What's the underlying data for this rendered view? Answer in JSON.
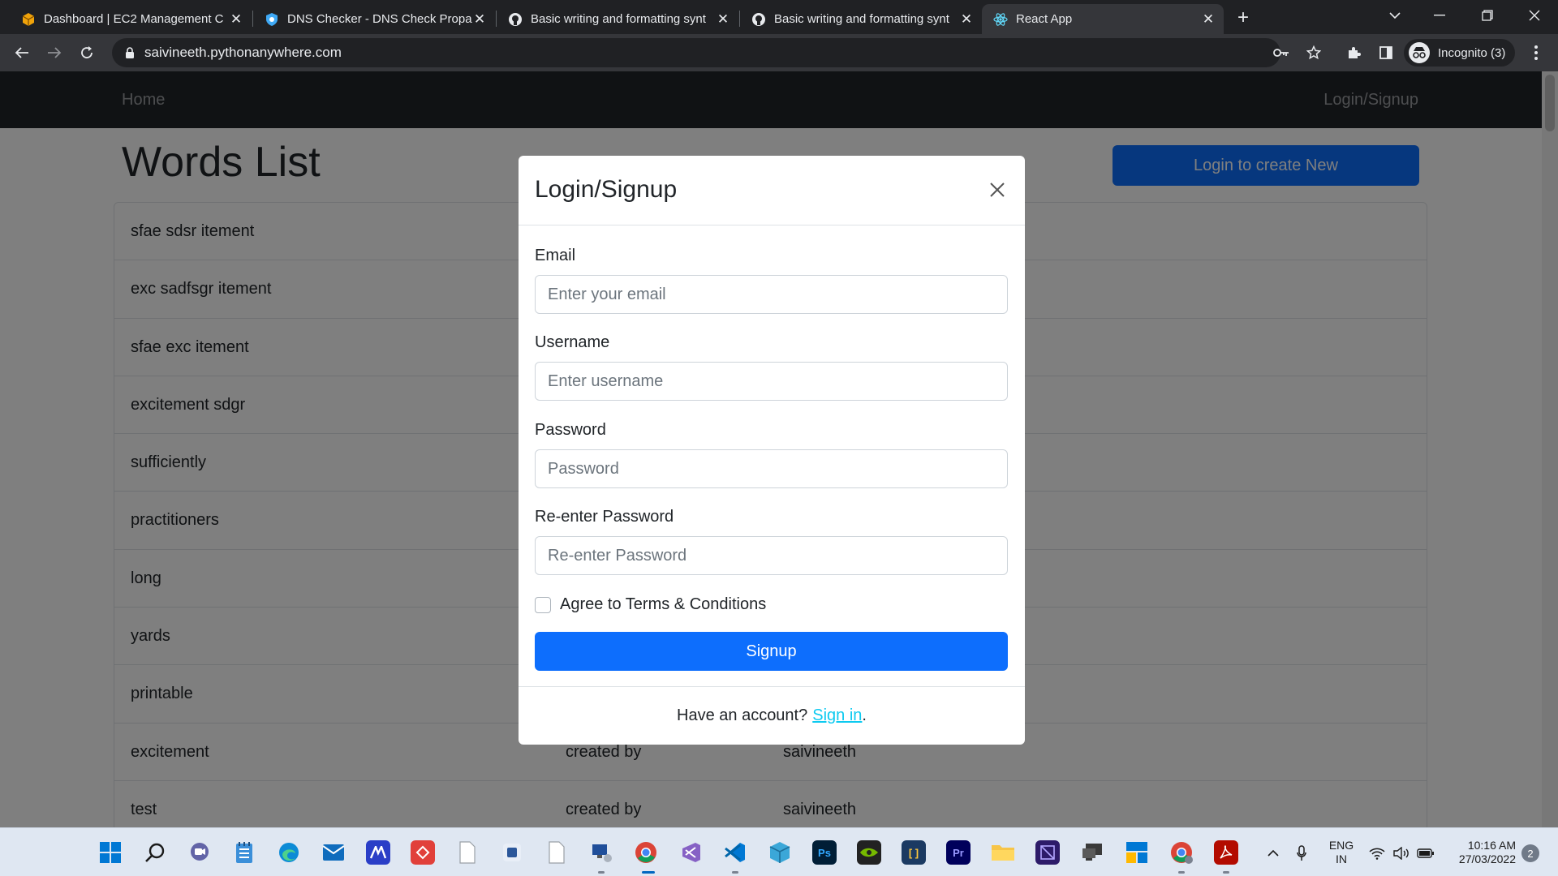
{
  "browser": {
    "tabs": [
      {
        "title": "Dashboard | EC2 Management C",
        "icon": "aws-cube-icon",
        "active": false
      },
      {
        "title": "DNS Checker - DNS Check Propa",
        "icon": "dns-checker-icon",
        "active": false
      },
      {
        "title": "Basic writing and formatting synt",
        "icon": "github-icon",
        "active": false
      },
      {
        "title": "Basic writing and formatting synt",
        "icon": "github-icon",
        "active": false
      },
      {
        "title": "React App",
        "icon": "react-icon",
        "active": true
      }
    ],
    "url": "saivineeth.pythonanywhere.com",
    "profile_label": "Incognito (3)"
  },
  "app": {
    "nav_home": "Home",
    "nav_login": "Login/Signup",
    "page_title": "Words List",
    "create_button": "Login to create New",
    "words": [
      {
        "word": "sfae sdsr itement",
        "by": "",
        "user": ""
      },
      {
        "word": "exc sadfsgr itement",
        "by": "",
        "user": ""
      },
      {
        "word": "sfae exc itement",
        "by": "",
        "user": ""
      },
      {
        "word": "excitement sdgr",
        "by": "",
        "user": ""
      },
      {
        "word": "sufficiently",
        "by": "",
        "user": ""
      },
      {
        "word": "practitioners",
        "by": "",
        "user": ""
      },
      {
        "word": "long",
        "by": "",
        "user": ""
      },
      {
        "word": "yards",
        "by": "",
        "user": ""
      },
      {
        "word": "printable",
        "by": "",
        "user": ""
      },
      {
        "word": "excitement",
        "by": "created by",
        "user": "saivineeth"
      },
      {
        "word": "test",
        "by": "created by",
        "user": "saivineeth"
      }
    ]
  },
  "modal": {
    "title": "Login/Signup",
    "email_label": "Email",
    "email_placeholder": "Enter your email",
    "username_label": "Username",
    "username_placeholder": "Enter username",
    "password_label": "Password",
    "password_placeholder": "Password",
    "repassword_label": "Re-enter Password",
    "repassword_placeholder": "Re-enter Password",
    "terms_label": "Agree to Terms & Conditions",
    "terms_checked": false,
    "signup_button": "Signup",
    "footer_text": "Have an account?",
    "signin_link": "Sign in",
    "footer_suffix": "."
  },
  "taskbar": {
    "language_line1": "ENG",
    "language_line2": "IN",
    "time": "10:16 AM",
    "date": "27/03/2022",
    "notifications": "2"
  },
  "colors": {
    "primary": "#0d6efd",
    "navbar": "#212529",
    "link": "#0dcaf0"
  }
}
